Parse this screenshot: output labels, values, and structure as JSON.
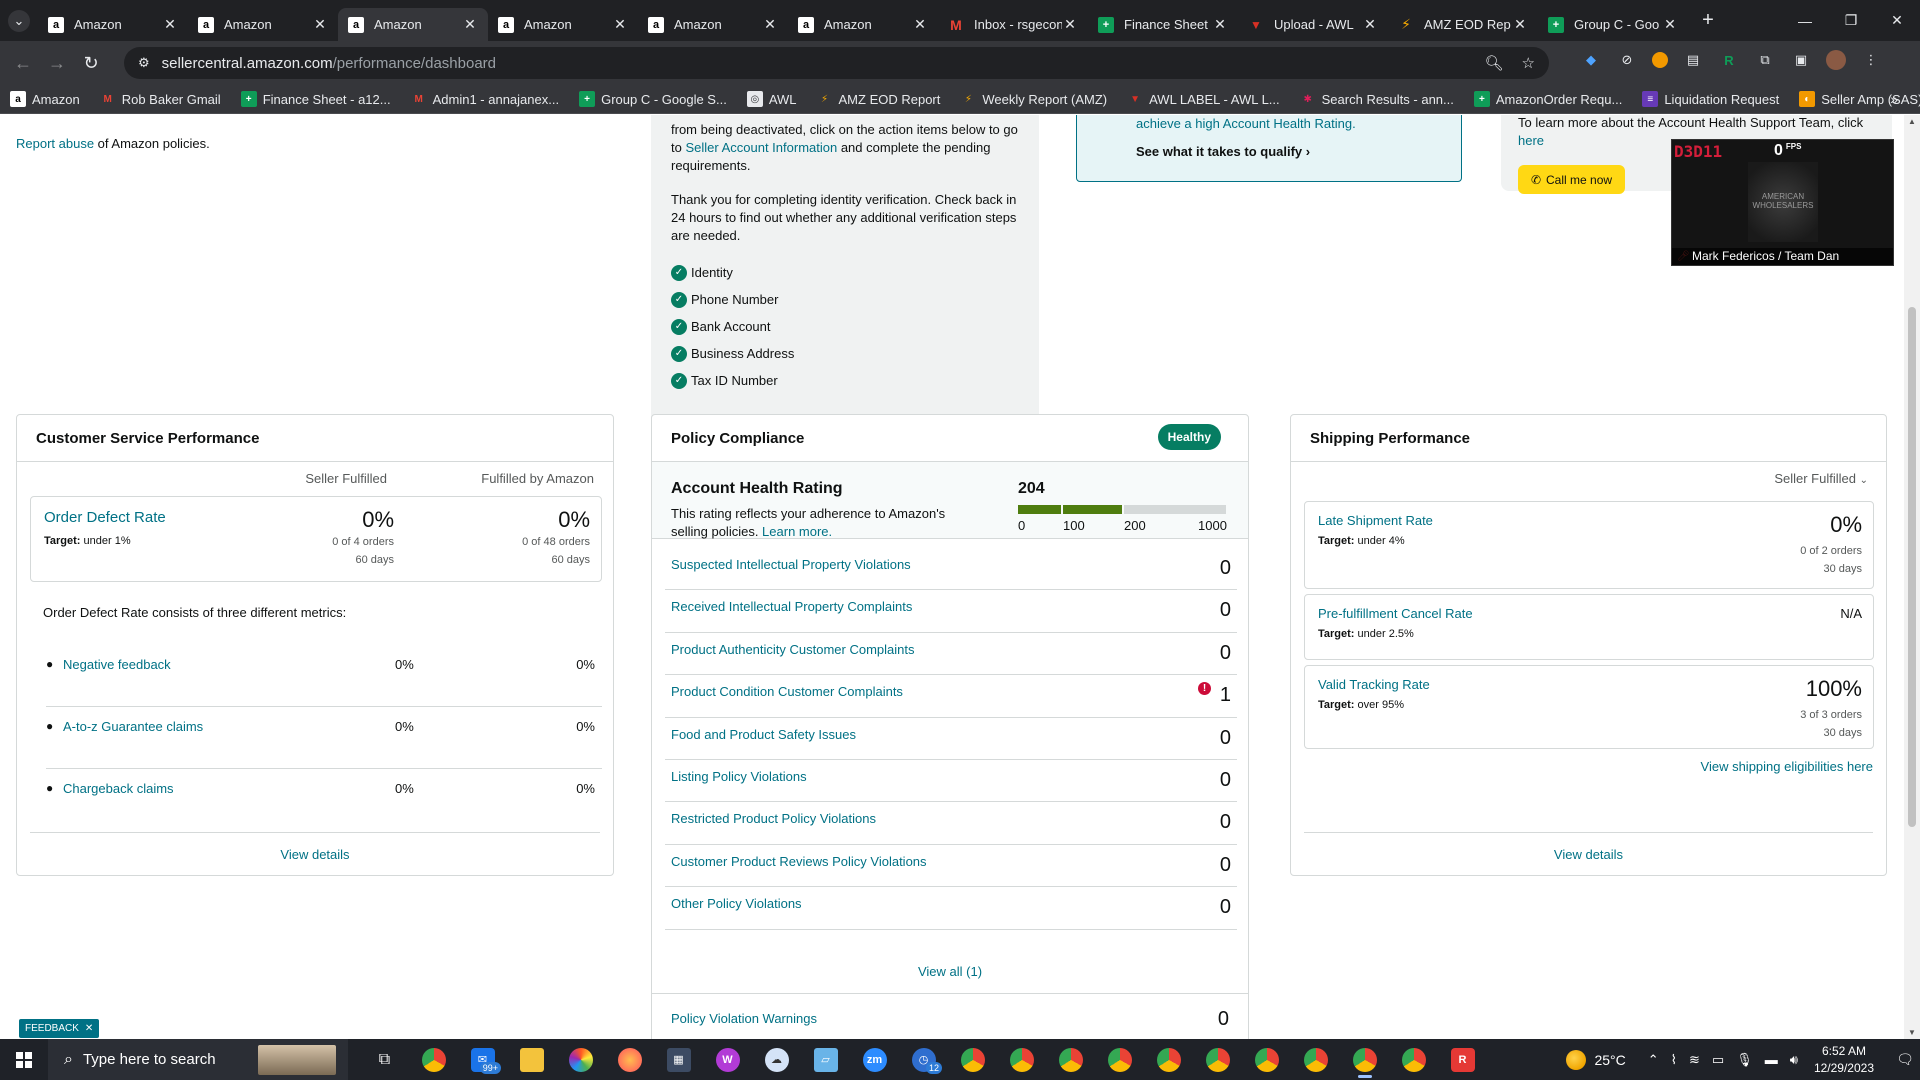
{
  "browser": {
    "tabs": [
      {
        "title": "Amazon",
        "icon": "amazon-icon",
        "active": false
      },
      {
        "title": "Amazon",
        "icon": "amazon-icon",
        "active": false
      },
      {
        "title": "Amazon",
        "icon": "amazon-icon",
        "active": true
      },
      {
        "title": "Amazon",
        "icon": "amazon-icon",
        "active": false
      },
      {
        "title": "Amazon",
        "icon": "amazon-icon",
        "active": false
      },
      {
        "title": "Amazon",
        "icon": "amazon-icon",
        "active": false
      },
      {
        "title": "Inbox - rsgecon",
        "icon": "gmail-icon",
        "active": false
      },
      {
        "title": "Finance Sheet",
        "icon": "sheets-icon",
        "active": false
      },
      {
        "title": "Upload - AWL",
        "icon": "awl-icon",
        "active": false
      },
      {
        "title": "AMZ EOD Rep",
        "icon": "eod-icon",
        "active": false
      },
      {
        "title": "Group C - Goo",
        "icon": "sheets-icon",
        "active": false
      }
    ],
    "url_domain": "sellercentral.amazon.com",
    "url_path": "/performance/dashboard",
    "bookmarks": [
      {
        "label": "Amazon",
        "icon": "amazon-icon"
      },
      {
        "label": "Rob Baker Gmail",
        "icon": "gmail-icon"
      },
      {
        "label": "Finance Sheet - a12...",
        "icon": "sheets-icon"
      },
      {
        "label": "Admin1 - annajanex...",
        "icon": "gmail-icon"
      },
      {
        "label": "Group C - Google S...",
        "icon": "sheets-icon"
      },
      {
        "label": "AWL",
        "icon": "globe-icon"
      },
      {
        "label": "AMZ EOD Report",
        "icon": "eod-icon"
      },
      {
        "label": "Weekly Report (AMZ)",
        "icon": "eod-icon"
      },
      {
        "label": "AWL LABEL - AWL L...",
        "icon": "awl-icon"
      },
      {
        "label": "Search Results - ann...",
        "icon": "slack-icon"
      },
      {
        "label": "AmazonOrder Requ...",
        "icon": "sheets-icon"
      },
      {
        "label": "Liquidation Request",
        "icon": "forms-icon"
      },
      {
        "label": "Seller Amp (SAS)",
        "icon": "selleramp-icon"
      }
    ]
  },
  "page": {
    "report_link": "Report abuse",
    "report_suffix": " of Amazon policies.",
    "verification": {
      "p1_prefix": "from being deactivated, click on the action items below to go to ",
      "p1_link": "Seller Account Information",
      "p1_suffix": " and complete the pending requirements.",
      "p2": "Thank you for completing identity verification. Check back in 24 hours to find out whether any additional verification steps are needed.",
      "items": [
        "Identity",
        "Phone Number",
        "Bank Account",
        "Business Address",
        "Tax ID Number"
      ]
    },
    "ahr_promo": {
      "text": "achieve a high Account Health Rating.",
      "cta": "See what it takes to qualify"
    },
    "support": {
      "text_prefix": "To learn more about the Account Health Support Team, click ",
      "text_link": "here",
      "call_button": "Call me now"
    },
    "video": {
      "code": "D3D11",
      "fps_value": "0",
      "fps_label": "FPS",
      "logo_text": "AMERICAN WHOLESALERS",
      "participant": "Mark Federicos / Team Dan"
    },
    "csp": {
      "title": "Customer Service Performance",
      "col_seller": "Seller Fulfilled",
      "col_fba": "Fulfilled by Amazon",
      "odr_label": "Order Defect Rate",
      "odr_target_label": "Target:",
      "odr_target": " under 1%",
      "seller": {
        "value": "0%",
        "orders": "0 of 4 orders",
        "period": "60 days"
      },
      "fba": {
        "value": "0%",
        "orders": "0 of 48 orders",
        "period": "60 days"
      },
      "description": "Order Defect Rate consists of three different metrics:",
      "metrics": [
        {
          "name": "Negative feedback",
          "seller": "0%",
          "fba": "0%"
        },
        {
          "name": "A-to-z Guarantee claims",
          "seller": "0%",
          "fba": "0%"
        },
        {
          "name": "Chargeback claims",
          "seller": "0%",
          "fba": "0%"
        }
      ],
      "view_details": "View details"
    },
    "policy": {
      "title": "Policy Compliance",
      "status": "Healthy",
      "ahr_title": "Account Health Rating",
      "ahr_desc_prefix": "This rating reflects your adherence to Amazon's selling policies. ",
      "ahr_desc_link": "Learn more.",
      "ahr_score": "204",
      "ahr_score_value": 204,
      "ahr_ticks": [
        "0",
        "100",
        "200",
        "1000"
      ],
      "colors": {
        "red": "#cc0c39",
        "green": "#067d62",
        "healthy_bar": "#4f7d0f",
        "grey": "#d5d9d9"
      },
      "rows": [
        {
          "name": "Suspected Intellectual Property Violations",
          "value": "0",
          "alert": false
        },
        {
          "name": "Received Intellectual Property Complaints",
          "value": "0",
          "alert": false
        },
        {
          "name": "Product Authenticity Customer Complaints",
          "value": "0",
          "alert": false
        },
        {
          "name": "Product Condition Customer Complaints",
          "value": "1",
          "alert": true
        },
        {
          "name": "Food and Product Safety Issues",
          "value": "0",
          "alert": false
        },
        {
          "name": "Listing Policy Violations",
          "value": "0",
          "alert": false
        },
        {
          "name": "Restricted Product Policy Violations",
          "value": "0",
          "alert": false
        },
        {
          "name": "Customer Product Reviews Policy Violations",
          "value": "0",
          "alert": false
        },
        {
          "name": "Other Policy Violations",
          "value": "0",
          "alert": false
        }
      ],
      "view_all": "View all (1)",
      "warnings_label": "Policy Violation Warnings",
      "warnings_value": "0"
    },
    "shipping": {
      "title": "Shipping Performance",
      "filter": "Seller Fulfilled",
      "late": {
        "label": "Late Shipment Rate",
        "target_label": "Target:",
        "target": " under 4%",
        "value": "0%",
        "orders": "0 of 2 orders",
        "period": "30 days"
      },
      "cancel": {
        "label": "Pre-fulfillment Cancel Rate",
        "target_label": "Target:",
        "target": " under 2.5%",
        "value": "N/A"
      },
      "tracking": {
        "label": "Valid Tracking Rate",
        "target_label": "Target:",
        "target": " over 95%",
        "value": "100%",
        "orders": "3 of 3 orders",
        "period": "30 days"
      },
      "eligibility_link": "View shipping eligibilities here",
      "view_details": "View details"
    },
    "feedback": "FEEDBACK"
  },
  "taskbar": {
    "search_placeholder": "Type here to search",
    "mail_badge": "99+",
    "calendar_badge": "12",
    "temperature": "25°C",
    "time": "6:52 AM",
    "date": "12/29/2023"
  }
}
